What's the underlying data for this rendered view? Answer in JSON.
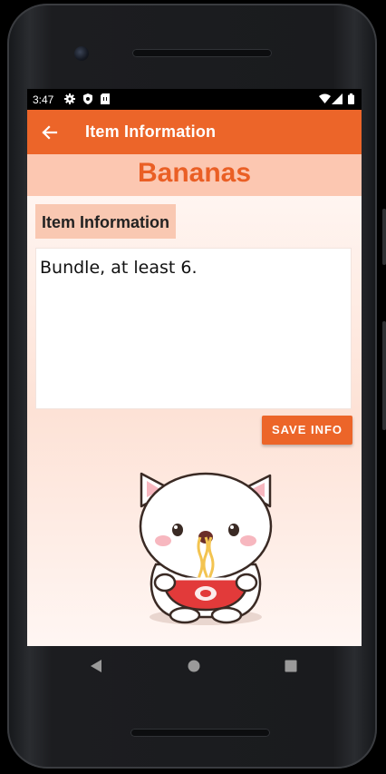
{
  "status_bar": {
    "time": "3:47"
  },
  "app_bar": {
    "title": "Item Information"
  },
  "item": {
    "name": "Bananas"
  },
  "section": {
    "label": "Item Information"
  },
  "info_field": {
    "value": "Bundle, at least 6."
  },
  "save_button": {
    "label": "SAVE INFO"
  },
  "colors": {
    "accent": "#ec6529",
    "name_text": "#ea5f25",
    "name_bar": "#fcc7b1"
  },
  "icons": {
    "back": "arrow-left-icon",
    "settings": "gear-icon",
    "shield": "shield-icon",
    "sim": "sim-card-icon",
    "wifi": "wifi-icon",
    "signal": "signal-icon",
    "battery": "battery-icon",
    "nav_back": "triangle-back-icon",
    "nav_home": "circle-home-icon",
    "nav_recents": "square-recents-icon"
  }
}
